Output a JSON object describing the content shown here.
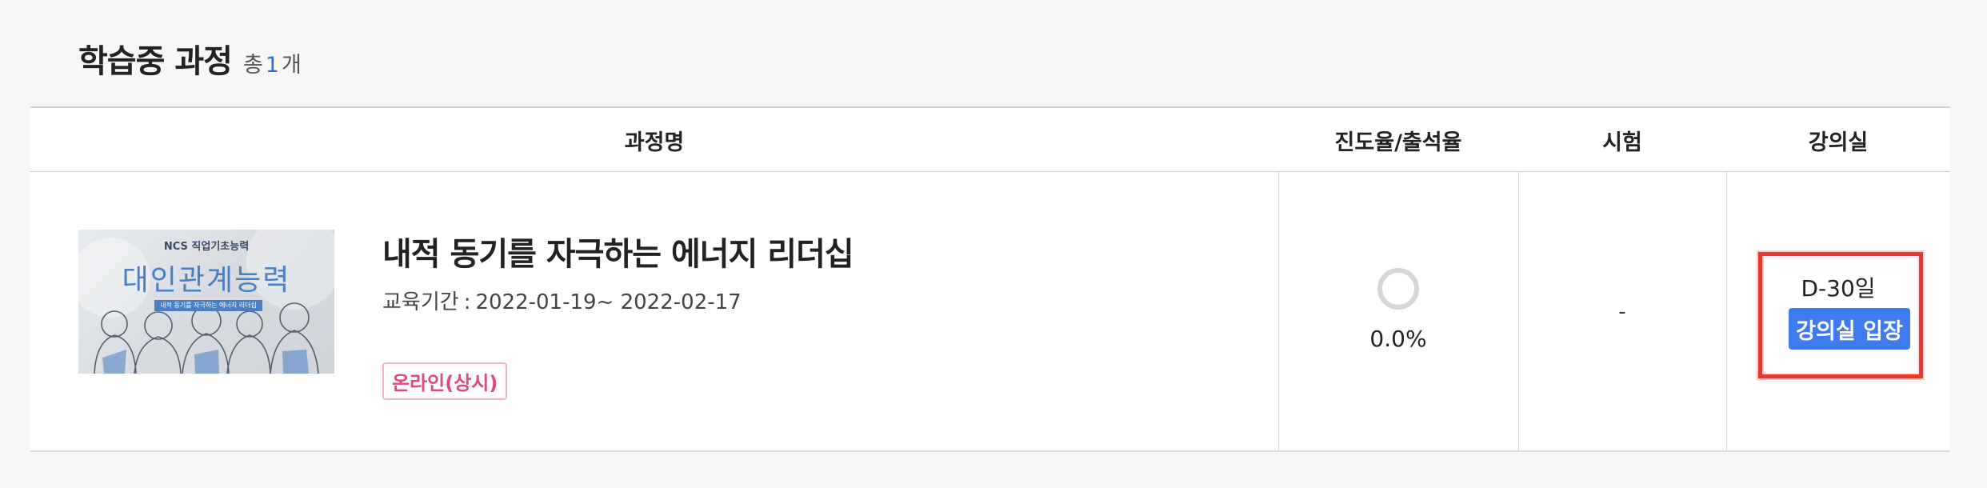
{
  "header": {
    "title": "학습중 과정",
    "count_prefix": "총",
    "count_value": "1",
    "count_suffix": "개"
  },
  "table": {
    "columns": {
      "course": "과정명",
      "progress": "진도율/출석율",
      "exam": "시험",
      "room": "강의실"
    },
    "rows": [
      {
        "thumbnail": {
          "subtitle": "NCS 직업기초능력",
          "main": "대인관계능력",
          "caption": "내적 동기를 자극하는 에너지 리더십"
        },
        "title": "내적 동기를 자극하는 에너지 리더십",
        "period_label": "교육기간",
        "period_sep": ":",
        "period_value": "2022-01-19~ 2022-02-17",
        "badge": "온라인(상시)",
        "progress_value": 0.0,
        "progress_text": "0.0%",
        "exam": "-",
        "d_day": "D-30일",
        "enter_button": "강의실 입장"
      }
    ]
  },
  "colors": {
    "accent_blue": "#3f7bee",
    "count_blue": "#2e6be6",
    "badge_pink": "#e04a79",
    "highlight_red": "#e8382f"
  }
}
